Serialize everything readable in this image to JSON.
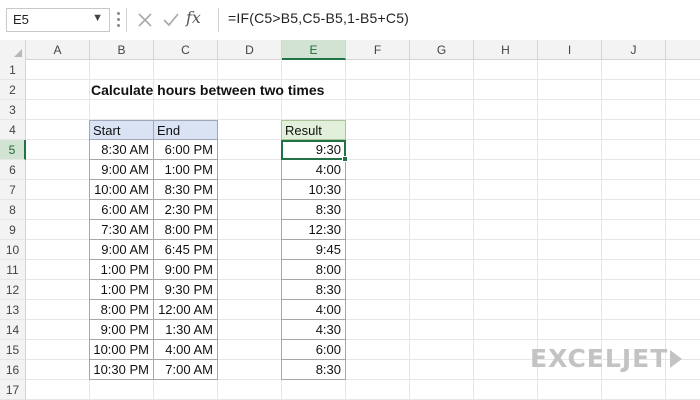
{
  "formula_bar": {
    "name_box": "E5",
    "fx_label": "fx",
    "formula": "=IF(C5>B5,C5-B5,1-B5+C5)"
  },
  "columns": [
    "A",
    "B",
    "C",
    "D",
    "E",
    "F",
    "G",
    "H",
    "I",
    "J"
  ],
  "active_column": "E",
  "rows": [
    "1",
    "2",
    "3",
    "4",
    "5",
    "6",
    "7",
    "8",
    "9",
    "10",
    "11",
    "12",
    "13",
    "14",
    "15",
    "16",
    "17"
  ],
  "active_row": "5",
  "sheet": {
    "title": "Calculate hours between two times",
    "headers": {
      "start": "Start",
      "end": "End",
      "result": "Result"
    },
    "data": [
      {
        "start": "8:30 AM",
        "end": "6:00 PM",
        "result": "9:30"
      },
      {
        "start": "9:00 AM",
        "end": "1:00 PM",
        "result": "4:00"
      },
      {
        "start": "10:00 AM",
        "end": "8:30 PM",
        "result": "10:30"
      },
      {
        "start": "6:00 AM",
        "end": "2:30 PM",
        "result": "8:30"
      },
      {
        "start": "7:30 AM",
        "end": "8:00 PM",
        "result": "12:30"
      },
      {
        "start": "9:00 AM",
        "end": "6:45 PM",
        "result": "9:45"
      },
      {
        "start": "1:00 PM",
        "end": "9:00 PM",
        "result": "8:00"
      },
      {
        "start": "1:00 PM",
        "end": "9:30 PM",
        "result": "8:30"
      },
      {
        "start": "8:00 PM",
        "end": "12:00 AM",
        "result": "4:00"
      },
      {
        "start": "9:00 PM",
        "end": "1:30 AM",
        "result": "4:30"
      },
      {
        "start": "10:00 PM",
        "end": "4:00 AM",
        "result": "6:00"
      },
      {
        "start": "10:30 PM",
        "end": "7:00 AM",
        "result": "8:30"
      }
    ]
  },
  "brand": {
    "logo_text": "EXCELJET",
    "accent": "#217346"
  }
}
